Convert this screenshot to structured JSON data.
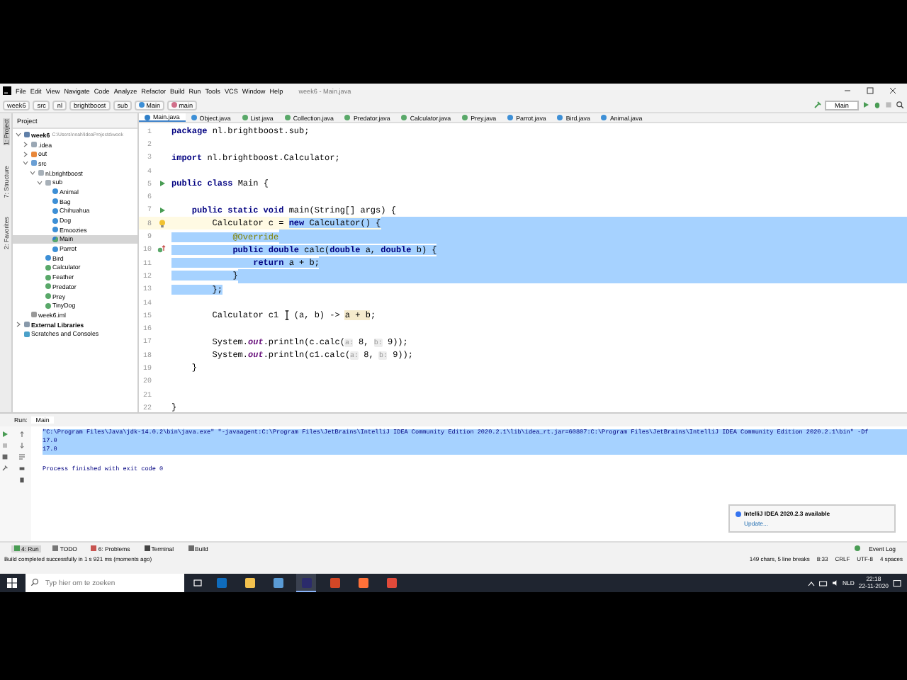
{
  "window": {
    "title": "week6 - Main.java"
  },
  "menu": [
    "File",
    "Edit",
    "View",
    "Navigate",
    "Code",
    "Analyze",
    "Refactor",
    "Build",
    "Run",
    "Tools",
    "VCS",
    "Window",
    "Help"
  ],
  "breadcrumbs": [
    {
      "label": "week6",
      "kind": "module"
    },
    {
      "label": "src",
      "kind": "folder"
    },
    {
      "label": "nl",
      "kind": "package"
    },
    {
      "label": "brightboost",
      "kind": "package"
    },
    {
      "label": "sub",
      "kind": "package"
    },
    {
      "label": "Main",
      "kind": "class"
    },
    {
      "label": "main",
      "kind": "method"
    }
  ],
  "run_config": "Main",
  "left_strip": [
    {
      "label": "1: Project",
      "selected": true
    },
    {
      "label": "7: Structure",
      "selected": false
    },
    {
      "label": "2: Favorites",
      "selected": false
    }
  ],
  "project_panel": {
    "title": "Project",
    "tree": [
      {
        "label": "week6",
        "path": "C:\\Users\\noah\\IdeaProjects\\week",
        "kind": "module",
        "expanded": true,
        "selected": false,
        "children": [
          {
            "label": ".idea",
            "kind": "folder",
            "expanded": false,
            "selected": false
          },
          {
            "label": "out",
            "kind": "excluded",
            "expanded": false,
            "selected": false
          },
          {
            "label": "src",
            "kind": "source",
            "expanded": true,
            "selected": false,
            "children": [
              {
                "label": "nl.brightboost",
                "kind": "package",
                "expanded": true,
                "selected": false,
                "children": [
                  {
                    "label": "sub",
                    "kind": "package",
                    "expanded": true,
                    "selected": false,
                    "children": [
                      {
                        "label": "Animal",
                        "kind": "class",
                        "selected": false
                      },
                      {
                        "label": "Bag",
                        "kind": "class",
                        "selected": false
                      },
                      {
                        "label": "Chihuahua",
                        "kind": "class",
                        "selected": false
                      },
                      {
                        "label": "Dog",
                        "kind": "class",
                        "selected": false
                      },
                      {
                        "label": "Emoozies",
                        "kind": "class",
                        "selected": false
                      },
                      {
                        "label": "Main",
                        "kind": "main",
                        "selected": true
                      },
                      {
                        "label": "Parrot",
                        "kind": "class",
                        "selected": false
                      }
                    ]
                  },
                  {
                    "label": "Bird",
                    "kind": "class",
                    "selected": false
                  },
                  {
                    "label": "Calculator",
                    "kind": "interface",
                    "selected": false
                  },
                  {
                    "label": "Feather",
                    "kind": "interface",
                    "selected": false
                  },
                  {
                    "label": "Predator",
                    "kind": "interface",
                    "selected": false
                  },
                  {
                    "label": "Prey",
                    "kind": "interface",
                    "selected": false
                  },
                  {
                    "label": "TinyDog",
                    "kind": "interface",
                    "selected": false
                  }
                ]
              }
            ]
          },
          {
            "label": "week6.iml",
            "kind": "file",
            "selected": false
          }
        ]
      },
      {
        "label": "External Libraries",
        "kind": "library",
        "expanded": false,
        "selected": false
      },
      {
        "label": "Scratches and Consoles",
        "kind": "scratch",
        "selected": false
      }
    ]
  },
  "editor": {
    "tabs": [
      {
        "label": "Main.java",
        "kind": "main",
        "selected": true
      },
      {
        "label": "Object.java",
        "kind": "class",
        "selected": false
      },
      {
        "label": "List.java",
        "kind": "interface",
        "selected": false
      },
      {
        "label": "Collection.java",
        "kind": "interface",
        "selected": false
      },
      {
        "label": "Predator.java",
        "kind": "interface",
        "selected": false
      },
      {
        "label": "Calculator.java",
        "kind": "interface",
        "selected": false
      },
      {
        "label": "Prey.java",
        "kind": "interface",
        "selected": false
      },
      {
        "label": "Parrot.java",
        "kind": "class",
        "selected": false
      },
      {
        "label": "Bird.java",
        "kind": "class",
        "selected": false
      },
      {
        "label": "Animal.java",
        "kind": "class",
        "selected": false
      }
    ],
    "lines": [
      {
        "number": "1",
        "current": false,
        "fill": false,
        "segments": [
          {
            "text": "package",
            "kind": "keyword",
            "selected": false
          },
          {
            "text": " nl.brightboost.sub;",
            "kind": "plain",
            "selected": false
          }
        ]
      },
      {
        "number": "2",
        "current": false,
        "fill": false
      },
      {
        "number": "3",
        "current": false,
        "fill": false,
        "segments": [
          {
            "text": "import",
            "kind": "keyword",
            "selected": false
          },
          {
            "text": " nl.brightboost.Calculator;",
            "kind": "plain",
            "selected": false
          }
        ]
      },
      {
        "number": "4",
        "current": false,
        "fill": false
      },
      {
        "number": "5",
        "gutter": {
          "kind": "run"
        },
        "current": false,
        "fill": false,
        "segments": [
          {
            "text": "public class",
            "kind": "keyword",
            "selected": false
          },
          {
            "text": " Main {",
            "kind": "plain",
            "selected": false
          }
        ]
      },
      {
        "number": "6",
        "current": false,
        "fill": false
      },
      {
        "number": "7",
        "gutter": {
          "kind": "run"
        },
        "current": false,
        "fill": false,
        "segments": [
          {
            "text": "    public static void",
            "kind": "keyword",
            "selected": false
          },
          {
            "text": " main(String[] args) {",
            "kind": "plain",
            "selected": false
          }
        ]
      },
      {
        "number": "8",
        "gutter": {
          "kind": "bulb"
        },
        "current": true,
        "fill": true,
        "segments": [
          {
            "text": "        Calculator c = ",
            "kind": "plain",
            "selected": false
          },
          {
            "text": "new",
            "kind": "keyword",
            "selected": true
          },
          {
            "text": " Calculator() {",
            "kind": "plain",
            "selected": true
          }
        ]
      },
      {
        "number": "9",
        "current": false,
        "fill": true,
        "segments": [
          {
            "text": "            @Override",
            "kind": "annotation",
            "selected": true
          }
        ]
      },
      {
        "number": "10",
        "gutter": {
          "kind": "override"
        },
        "current": false,
        "fill": true,
        "segments": [
          {
            "text": "            public double",
            "kind": "keyword",
            "selected": true
          },
          {
            "text": " calc(",
            "kind": "plain",
            "selected": true
          },
          {
            "text": "double",
            "kind": "keyword",
            "selected": true
          },
          {
            "text": " a, ",
            "kind": "plain",
            "selected": true
          },
          {
            "text": "double",
            "kind": "keyword",
            "selected": true
          },
          {
            "text": " b) {",
            "kind": "plain",
            "selected": true
          }
        ]
      },
      {
        "number": "11",
        "current": false,
        "fill": true,
        "segments": [
          {
            "text": "                return",
            "kind": "keyword",
            "selected": true
          },
          {
            "text": " a + b;",
            "kind": "plain",
            "selected": true
          }
        ]
      },
      {
        "number": "12",
        "current": false,
        "fill": true,
        "segments": [
          {
            "text": "            }",
            "kind": "plain",
            "selected": true
          }
        ]
      },
      {
        "number": "13",
        "current": false,
        "fill": false,
        "segments": [
          {
            "text": "        };",
            "kind": "plain",
            "selected": true
          }
        ]
      },
      {
        "number": "14",
        "current": false,
        "fill": false
      },
      {
        "number": "15",
        "current": false,
        "fill": false,
        "segments": [
          {
            "text": "        Calculator c1   (a, b) -> ",
            "kind": "plain",
            "selected": false
          },
          {
            "text": "a + b",
            "kind": "highlight",
            "selected": false
          },
          {
            "text": ";",
            "kind": "plain",
            "selected": false
          }
        ]
      },
      {
        "number": "16",
        "current": false,
        "fill": false
      },
      {
        "number": "17",
        "current": false,
        "fill": false,
        "segments": [
          {
            "text": "        System.",
            "kind": "plain",
            "selected": false
          },
          {
            "text": "out",
            "kind": "field",
            "selected": false
          },
          {
            "text": ".println(c.calc(",
            "kind": "plain",
            "selected": false
          },
          {
            "text": "a:",
            "kind": "hint",
            "selected": false
          },
          {
            "text": " 8, ",
            "kind": "plain",
            "selected": false
          },
          {
            "text": "b:",
            "kind": "hint",
            "selected": false
          },
          {
            "text": " 9));",
            "kind": "plain",
            "selected": false
          }
        ]
      },
      {
        "number": "18",
        "current": false,
        "fill": false,
        "segments": [
          {
            "text": "        System.",
            "kind": "plain",
            "selected": false
          },
          {
            "text": "out",
            "kind": "field",
            "selected": false
          },
          {
            "text": ".println(c1.calc(",
            "kind": "plain",
            "selected": false
          },
          {
            "text": "a:",
            "kind": "hint",
            "selected": false
          },
          {
            "text": " 8, ",
            "kind": "plain",
            "selected": false
          },
          {
            "text": "b:",
            "kind": "hint",
            "selected": false
          },
          {
            "text": " 9));",
            "kind": "plain",
            "selected": false
          }
        ]
      },
      {
        "number": "19",
        "current": false,
        "fill": false,
        "segments": [
          {
            "text": "    }",
            "kind": "plain",
            "selected": false
          }
        ]
      },
      {
        "number": "20",
        "current": false,
        "fill": false
      },
      {
        "number": "21",
        "current": false,
        "fill": false
      },
      {
        "number": "22",
        "current": false,
        "fill": false,
        "segments": [
          {
            "text": "}",
            "kind": "plain",
            "selected": false
          }
        ]
      }
    ]
  },
  "run_panel": {
    "label": "Run:",
    "tab": "Main",
    "output": [
      {
        "text": "\"C:\\Program Files\\Java\\jdk-14.0.2\\bin\\java.exe\" \"-javaagent:C:\\Program Files\\JetBrains\\IntelliJ IDEA Community Edition 2020.2.1\\lib\\idea_rt.jar=60807:C:\\Program Files\\JetBrains\\IntelliJ IDEA Community Edition 2020.2.1\\bin\" -Df",
        "selected": true
      },
      {
        "text": "17.0",
        "selected": true
      },
      {
        "text": "17.0",
        "selected": true
      },
      {
        "text": "Process finished with exit code 0",
        "selected": false
      }
    ]
  },
  "notification": {
    "title": "IntelliJ IDEA 2020.2.3 available",
    "link": "Update..."
  },
  "tool_windows": [
    {
      "label": "4: Run",
      "kind": "run",
      "selected": true
    },
    {
      "label": "TODO",
      "kind": "todo",
      "selected": false
    },
    {
      "label": "6: Problems",
      "kind": "problems",
      "selected": false
    },
    {
      "label": "Terminal",
      "kind": "terminal",
      "selected": false
    },
    {
      "label": "Build",
      "kind": "build",
      "selected": false
    }
  ],
  "event_log": "Event Log",
  "status_bar": {
    "message": "Build completed successfully in 1 s 921 ms (moments ago)",
    "items": [
      "149 chars, 5 line breaks",
      "8:33",
      "CRLF",
      "UTF-8",
      "4 spaces"
    ]
  },
  "taskbar": {
    "search_placeholder": "Typ hier om te zoeken",
    "apps": [
      {
        "kind": "outlook",
        "selected": false
      },
      {
        "kind": "explorer",
        "selected": false
      },
      {
        "kind": "notes",
        "selected": false
      },
      {
        "kind": "intellij",
        "selected": true
      },
      {
        "kind": "powerpoint",
        "selected": false
      },
      {
        "kind": "firefox",
        "selected": false
      },
      {
        "kind": "other",
        "selected": false
      }
    ],
    "language": "NLD",
    "time": "22:18",
    "date": "22-11-2020"
  }
}
